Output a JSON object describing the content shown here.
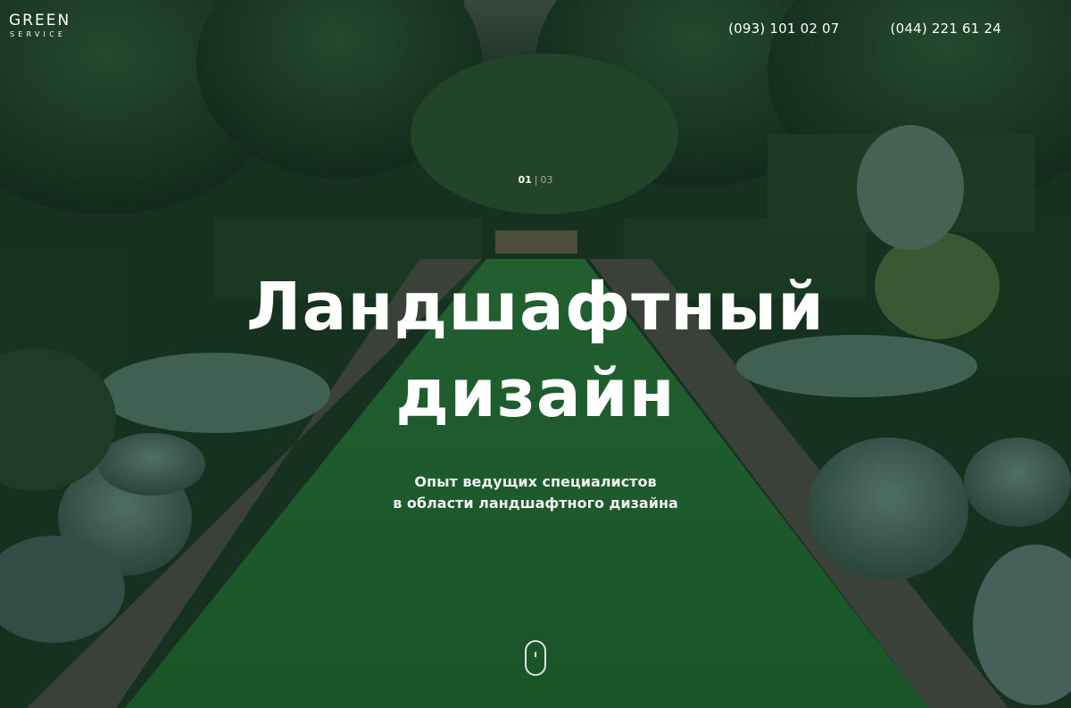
{
  "header": {
    "logo": {
      "main": "GREEN",
      "sub": "SERVICE"
    },
    "phones": [
      "(093) 101 02 07",
      "(044) 221 61 24"
    ]
  },
  "slider": {
    "current": "01",
    "separator": "|",
    "total": "03"
  },
  "hero": {
    "title_line1": "Ландшафтный",
    "title_line2": "дизайн",
    "subtitle_line1": "Опыт ведущих специалистов",
    "subtitle_line2": "в области ландшафтного дизайна"
  },
  "scroll_indicator": {
    "icon": "mouse-scroll-icon"
  },
  "colors": {
    "lawn": "#1f6b32",
    "foliage": "#1e4a2c",
    "text": "#ffffff"
  }
}
